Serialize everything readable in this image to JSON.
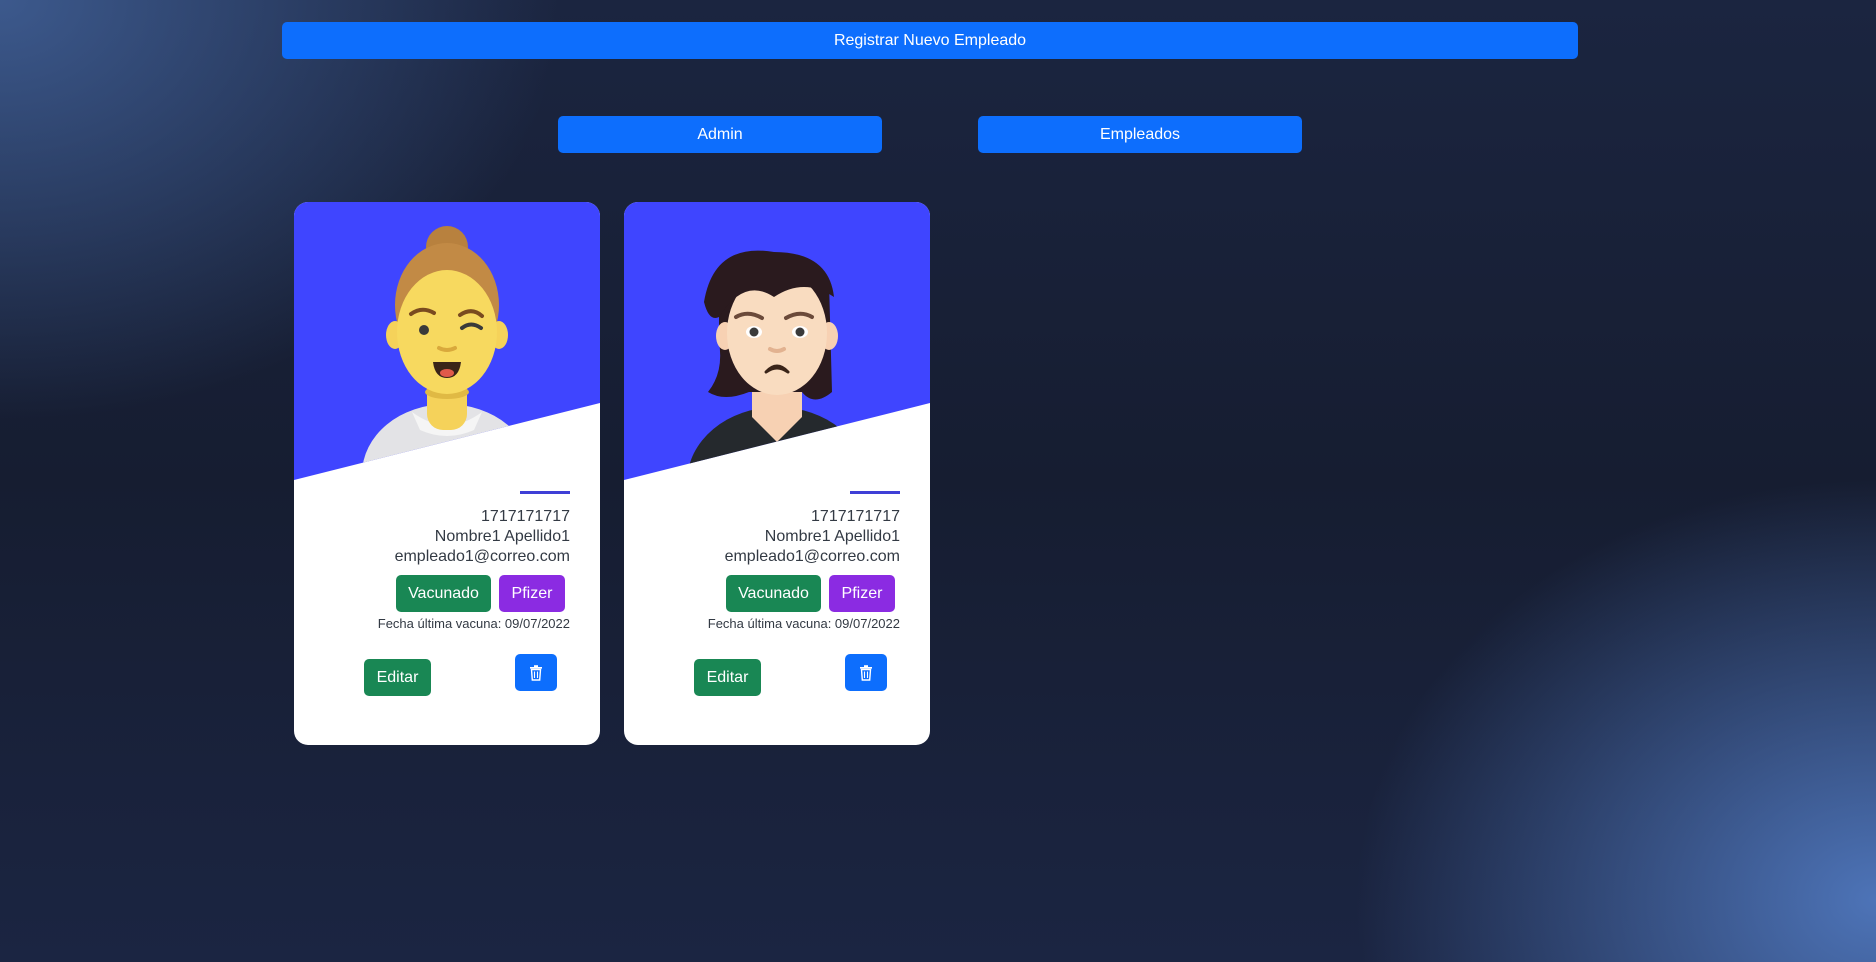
{
  "top": {
    "register_label": "Registrar Nuevo Empleado",
    "admin_label": "Admin",
    "empleados_label": "Empleados"
  },
  "colors": {
    "primary": "#0d6efd",
    "success": "#198754",
    "purple": "#8b2be2",
    "card_header": "#3f45ff"
  },
  "employees": [
    {
      "avatar": "smiling-man-avatar",
      "cedula": "1717171717",
      "name": "Nombre1 Apellido1",
      "email": "empleado1@correo.com",
      "status": "Vacunado",
      "vaccine": "Pfizer",
      "last_vaccine_date": "Fecha última vacuna: 09/07/2022",
      "edit_label": "Editar",
      "delete_icon": "trash-icon"
    },
    {
      "avatar": "worried-woman-avatar",
      "cedula": "1717171717",
      "name": "Nombre1 Apellido1",
      "email": "empleado1@correo.com",
      "status": "Vacunado",
      "vaccine": "Pfizer",
      "last_vaccine_date": "Fecha última vacuna: 09/07/2022",
      "edit_label": "Editar",
      "delete_icon": "trash-icon"
    }
  ]
}
